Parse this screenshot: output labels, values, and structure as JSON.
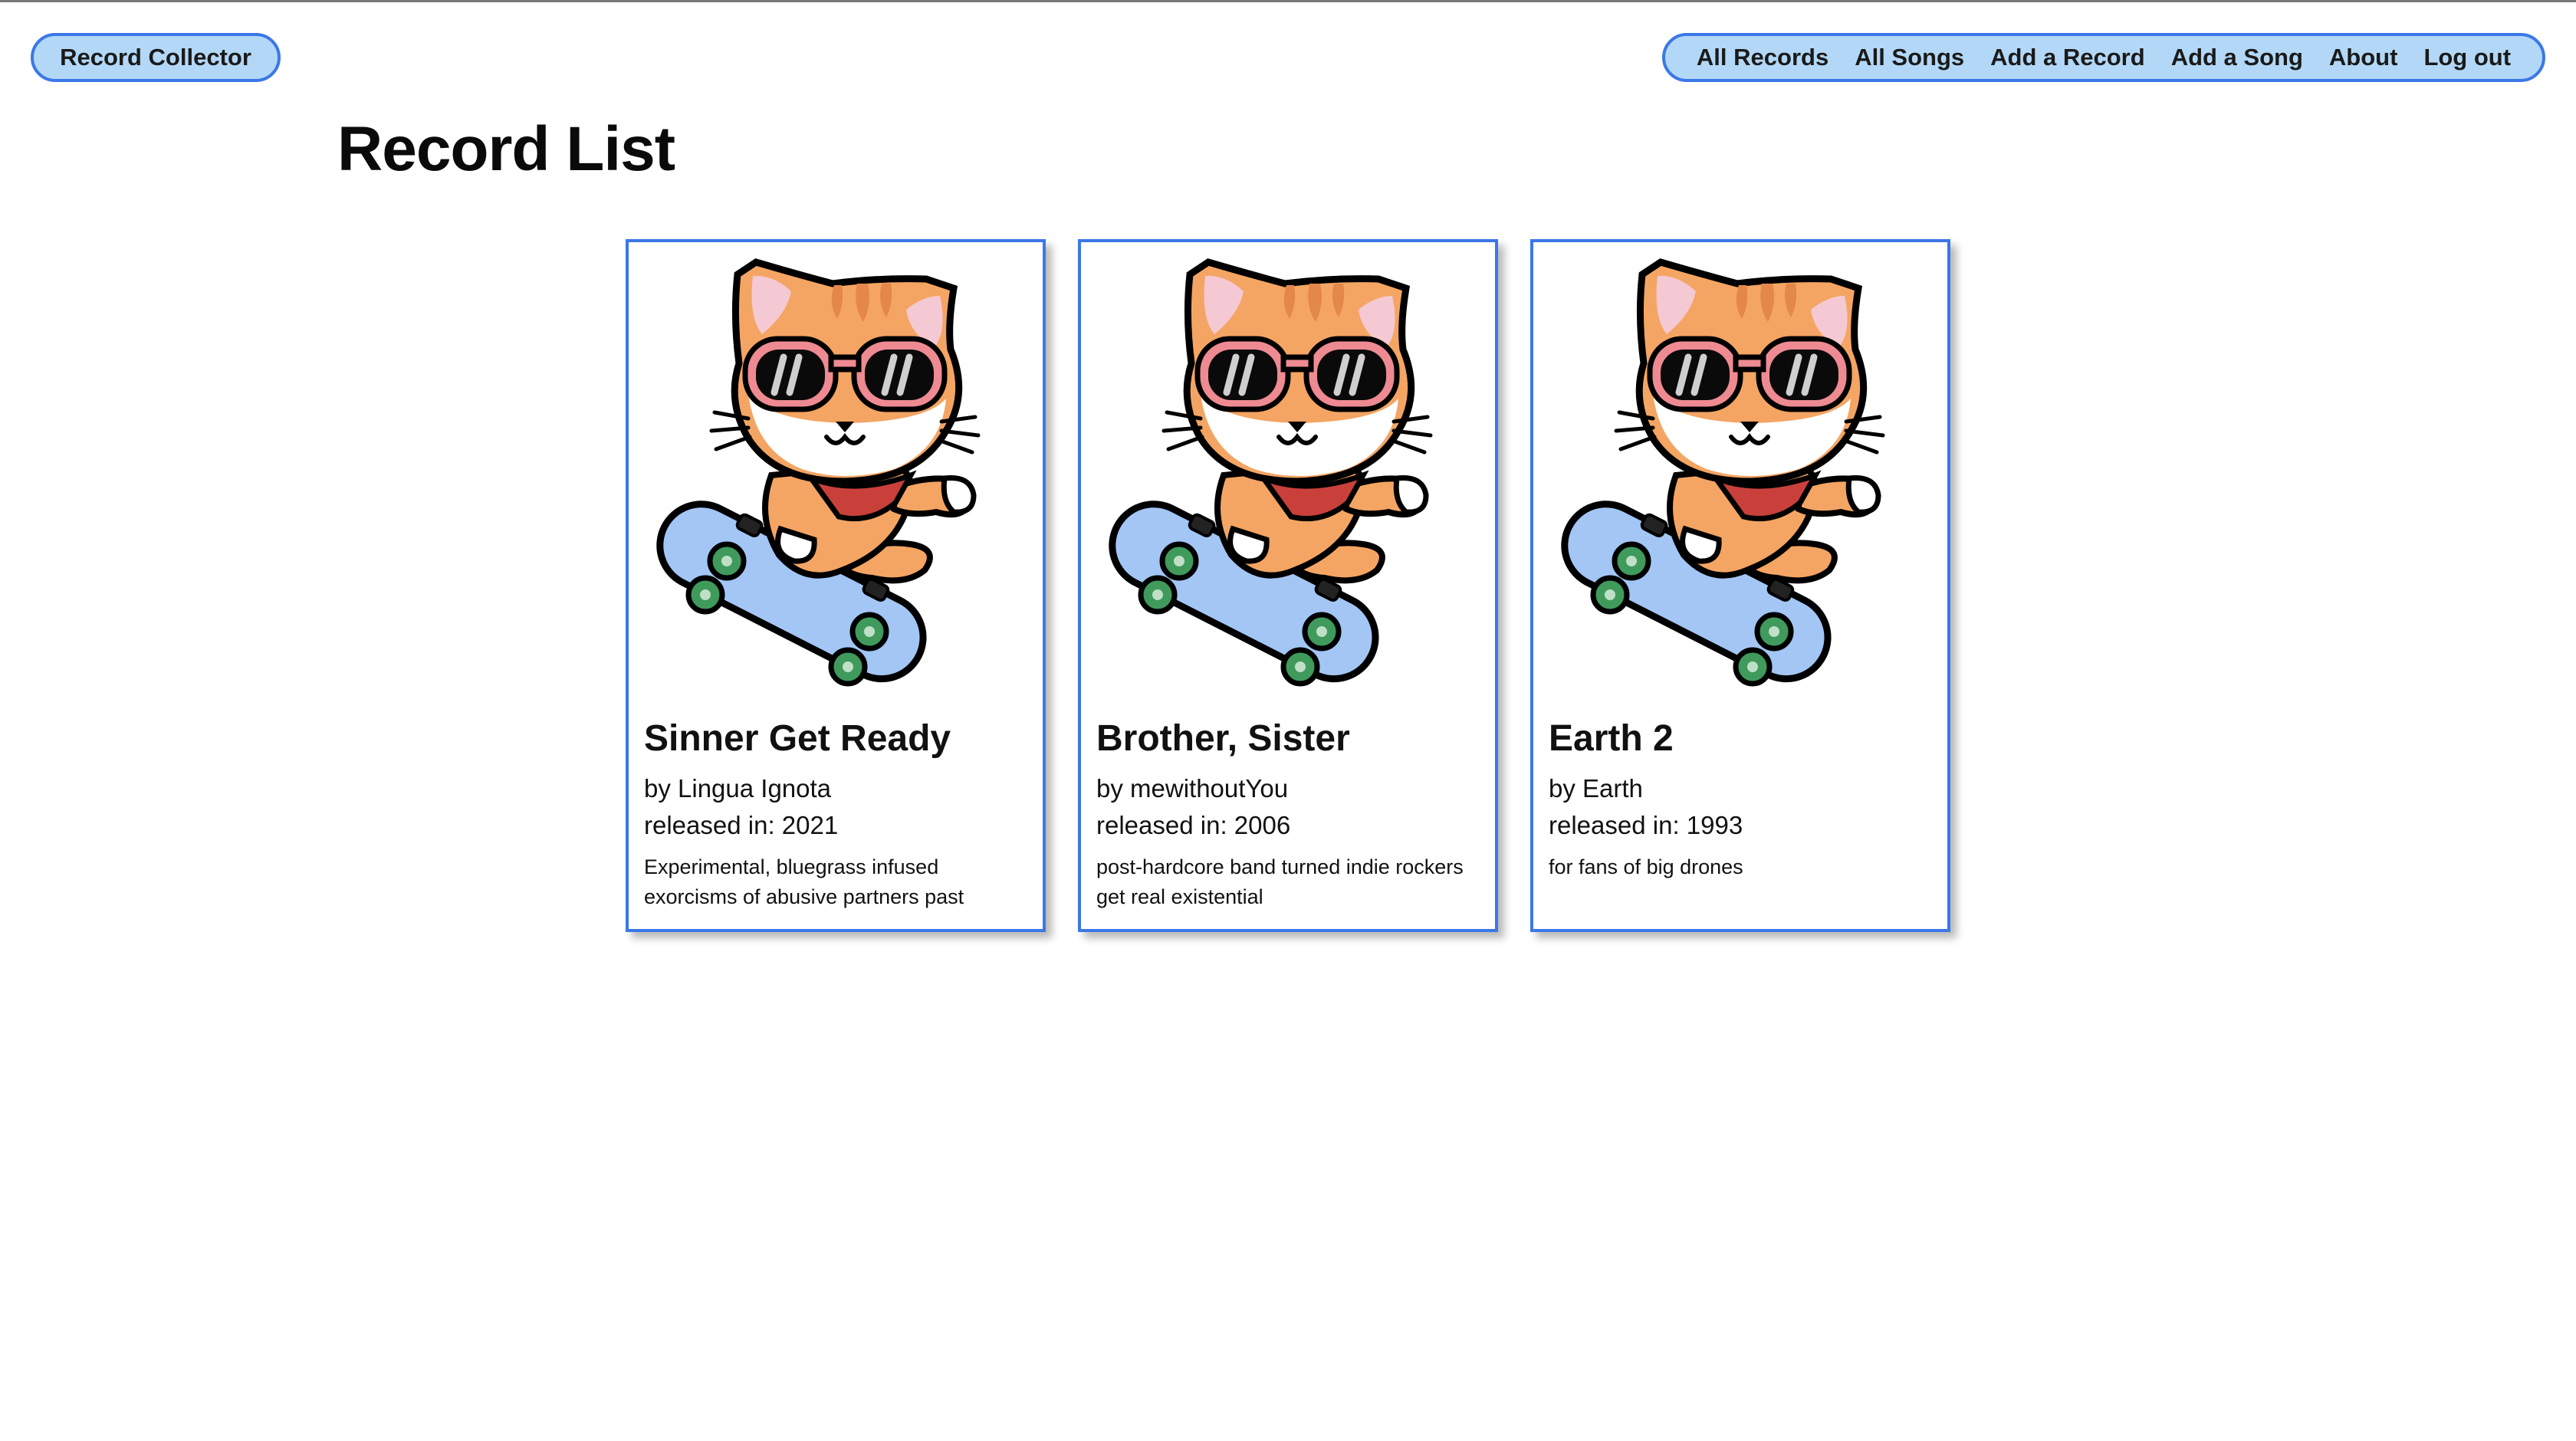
{
  "header": {
    "brand_label": "Record Collector",
    "nav": [
      {
        "label": "All Records"
      },
      {
        "label": "All Songs"
      },
      {
        "label": "Add a Record"
      },
      {
        "label": "Add a Song"
      },
      {
        "label": "About"
      },
      {
        "label": "Log out"
      }
    ]
  },
  "main": {
    "title": "Record List",
    "records": [
      {
        "title": "Sinner Get Ready",
        "artist_line": "by Lingua Ignota",
        "released_line": "released in: 2021",
        "description": "Experimental, bluegrass infused exorcisms of abusive partners past",
        "image_icon": "skateboarding-cat-icon"
      },
      {
        "title": "Brother, Sister",
        "artist_line": "by mewithoutYou",
        "released_line": "released in: 2006",
        "description": "post-hardcore band turned indie rockers get real existential",
        "image_icon": "skateboarding-cat-icon"
      },
      {
        "title": "Earth 2",
        "artist_line": "by Earth",
        "released_line": "released in: 1993",
        "description": "for fans of big drones",
        "image_icon": "skateboarding-cat-icon"
      }
    ]
  },
  "colors": {
    "accent_border": "#3b78e7",
    "pill_fill": "#b3d8f7",
    "cat_orange": "#f4a563",
    "cat_stripe": "#e3874a",
    "glasses_pink": "#ee8a92",
    "bandana_red": "#c9403b",
    "skateboard_blue": "#a3c6f5",
    "wheel_green": "#3f9a5c"
  }
}
